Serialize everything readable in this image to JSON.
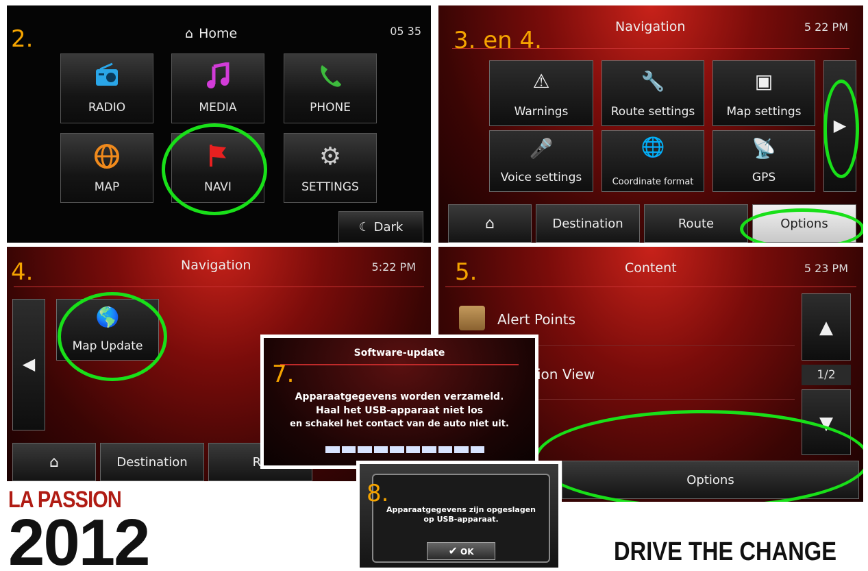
{
  "panel_home": {
    "step": "2.",
    "title": "Home",
    "clock": "05 35",
    "tiles": [
      {
        "label": "RADIO",
        "icon": "radio-icon"
      },
      {
        "label": "MEDIA",
        "icon": "music-note-icon"
      },
      {
        "label": "PHONE",
        "icon": "phone-icon"
      },
      {
        "label": "MAP",
        "icon": "globe-icon"
      },
      {
        "label": "NAVI",
        "icon": "flag-icon"
      },
      {
        "label": "SETTINGS",
        "icon": "gear-icon"
      }
    ],
    "dark_button": "Dark"
  },
  "panel_options": {
    "step": "3. en 4.",
    "title": "Navigation",
    "clock": "5 22 PM",
    "tiles": [
      {
        "label": "Warnings",
        "icon": "warning-icon"
      },
      {
        "label": "Route settings",
        "icon": "wrench-icon"
      },
      {
        "label": "Map settings",
        "icon": "map-settings-icon"
      },
      {
        "label": "Voice settings",
        "icon": "microphone-icon"
      },
      {
        "label": "Coordinate format",
        "icon": "coordinate-globe-icon"
      },
      {
        "label": "GPS",
        "icon": "satellite-icon"
      }
    ],
    "tabs": [
      "Destination",
      "Route",
      "Options"
    ]
  },
  "panel_map_update": {
    "step": "4.",
    "title": "Navigation",
    "clock": "5:22 PM",
    "tile_label": "Map Update",
    "tabs": [
      "Destination",
      "Ro"
    ]
  },
  "panel_content": {
    "step": "5.",
    "title": "Content",
    "clock": "5 23 PM",
    "items": [
      "Alert Points",
      "ion View"
    ],
    "page": "1/2",
    "options_button": "Options"
  },
  "photo_update": {
    "step": "7.",
    "title": "Software-update",
    "message_line1": "Apparaatgegevens worden verzameld.",
    "message_line2": "Haal het USB-apparaat niet los",
    "message_line3": "en schakel het contact van de auto niet uit."
  },
  "photo_done": {
    "step": "8.",
    "message_line1": "Apparaatgegevens zijn opgeslagen",
    "message_line2": "op USB-apparaat.",
    "ok_label": "OK"
  },
  "brand_left_line1": "LA PASSION",
  "brand_left_line2": "2012",
  "brand_right": "DRIVE THE CHANGE",
  "colors": {
    "highlight_ring": "#19e019",
    "step_number": "#f5a400",
    "accent_red": "#b01c14"
  }
}
